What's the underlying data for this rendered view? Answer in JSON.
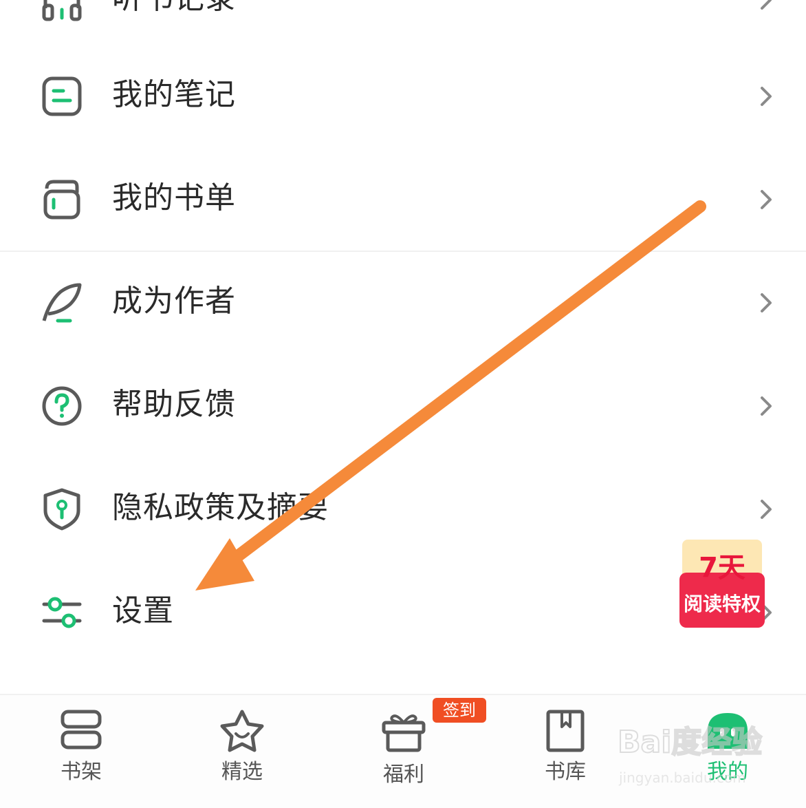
{
  "menu": {
    "items": [
      {
        "label": "听书记录",
        "icon": "headphones-icon"
      },
      {
        "label": "我的笔记",
        "icon": "note-icon"
      },
      {
        "label": "我的书单",
        "icon": "booklist-icon"
      },
      {
        "label": "成为作者",
        "icon": "quill-icon"
      },
      {
        "label": "帮助反馈",
        "icon": "help-icon"
      },
      {
        "label": "隐私政策及摘要",
        "icon": "shield-icon"
      },
      {
        "label": "设置",
        "icon": "sliders-icon"
      }
    ]
  },
  "promo": {
    "days": "7天",
    "text": "阅读特权"
  },
  "tabbar": {
    "tabs": [
      {
        "label": "书架",
        "icon": "bookshelf-icon"
      },
      {
        "label": "精选",
        "icon": "star-icon"
      },
      {
        "label": "福利",
        "icon": "gift-icon"
      },
      {
        "label": "书库",
        "icon": "library-icon"
      },
      {
        "label": "我的",
        "icon": "avatar-icon",
        "active": true
      }
    ],
    "badge": "签到"
  },
  "watermark": {
    "brand": "Bai度经验",
    "url": "jingyan.baidu.com"
  },
  "colors": {
    "accent": "#1dbf73",
    "arrow": "#f58a3a",
    "badge": "#f04e23",
    "icon_stroke": "#5a5a5a",
    "promo_red": "#ee2a4b"
  }
}
